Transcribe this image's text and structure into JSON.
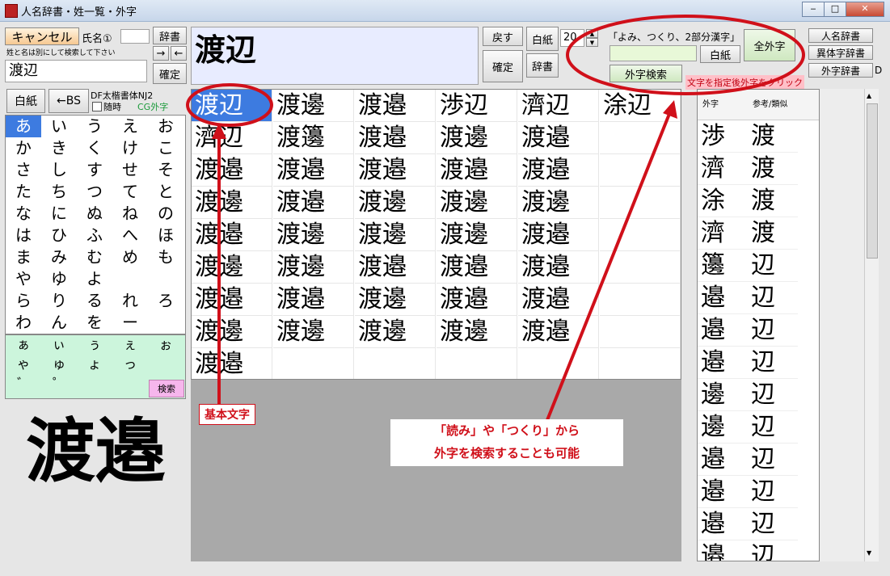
{
  "window": {
    "title": "人名辞書・姓一覧・外字",
    "min": "‒",
    "max": "□",
    "close": "✕"
  },
  "left": {
    "cancel": "キャンセル",
    "name_label": "氏名①",
    "dict_button": "辞書",
    "hint": "姓と名は別にして検索して下さい",
    "arrow_right": "→",
    "arrow_left": "←",
    "input_value": "渡辺",
    "confirm": "確定",
    "blank": "白紙",
    "bs": "←BS",
    "font_name": "DF太楷書体NJ2",
    "checkbox_label": "随時",
    "cg_label": "CG外字",
    "kana_rows": [
      [
        "あ",
        "い",
        "う",
        "え",
        "お"
      ],
      [
        "か",
        "き",
        "く",
        "け",
        "こ"
      ],
      [
        "さ",
        "し",
        "す",
        "せ",
        "そ"
      ],
      [
        "た",
        "ち",
        "つ",
        "て",
        "と"
      ],
      [
        "な",
        "に",
        "ぬ",
        "ね",
        "の"
      ],
      [
        "は",
        "ひ",
        "ふ",
        "へ",
        "ほ"
      ],
      [
        "ま",
        "み",
        "む",
        "め",
        "も"
      ],
      [
        "や",
        "ゆ",
        "よ",
        "",
        ""
      ],
      [
        "ら",
        "り",
        "る",
        "れ",
        "ろ"
      ],
      [
        "わ",
        "ん",
        "を",
        "ー",
        ""
      ]
    ],
    "small_rows": [
      [
        "ぁ",
        "ぃ",
        "ぅ",
        "ぇ",
        "ぉ"
      ],
      [
        "ゃ",
        "ゅ",
        "ょ",
        "っ",
        ""
      ],
      [
        "゛",
        "゜",
        "",
        "",
        ""
      ]
    ],
    "search": "検索",
    "big_preview": "渡邉"
  },
  "center": {
    "display": "渡辺",
    "back": "戻す",
    "confirm": "確定",
    "blank": "白紙",
    "dict": "辞書"
  },
  "right_top": {
    "size": "20",
    "search_caption": "「よみ、つくり、2部分漢字」",
    "blank": "白紙",
    "all_gaiji": "全外字",
    "gaiji_search": "外字検索",
    "gaiji_hint": "文字を指定後外字をクリック",
    "jinmei": "人名辞書",
    "itaiji": "異体字辞書",
    "gaiji_dict": "外字辞書",
    "d": "D"
  },
  "grid": [
    [
      "渡辺",
      "渡邊",
      "渡邉",
      "渉辺",
      "濟辺",
      "涂辺"
    ],
    [
      "濟辺",
      "渡籩",
      "渡邉",
      "渡邊",
      "渡邉",
      ""
    ],
    [
      "渡邉",
      "渡邉",
      "渡邉",
      "渡邉",
      "渡邉",
      ""
    ],
    [
      "渡邊",
      "渡邉",
      "渡邊",
      "渡邊",
      "渡邊",
      ""
    ],
    [
      "渡邉",
      "渡邊",
      "渡邊",
      "渡邊",
      "渡邉",
      ""
    ],
    [
      "渡邊",
      "渡邊",
      "渡邉",
      "渡邉",
      "渡邉",
      ""
    ],
    [
      "渡邉",
      "渡邉",
      "渡邊",
      "渡邉",
      "渡邉",
      ""
    ],
    [
      "渡邊",
      "渡邊",
      "渡邊",
      "渡邊",
      "渡邉",
      ""
    ],
    [
      "渡邉",
      "",
      "",
      "",
      "",
      ""
    ]
  ],
  "right_list": {
    "head1": "外字",
    "head2": "参考/類似",
    "rows": [
      [
        "渉",
        "渡"
      ],
      [
        "濟",
        "渡"
      ],
      [
        "涂",
        "渡"
      ],
      [
        "濟",
        "渡"
      ],
      [
        "籩",
        "辺"
      ],
      [
        "邉",
        "辺"
      ],
      [
        "邉",
        "辺"
      ],
      [
        "邉",
        "辺"
      ],
      [
        "邊",
        "辺"
      ],
      [
        "邊",
        "辺"
      ],
      [
        "邉",
        "辺"
      ],
      [
        "邉",
        "辺"
      ],
      [
        "邉",
        "辺"
      ],
      [
        "邉",
        "辺"
      ]
    ]
  },
  "annotations": {
    "basic": "基本文字",
    "line1": "「読み」や「つくり」から",
    "line2": "外字を検索することも可能"
  },
  "colors": {
    "selection": "#3d7be0",
    "annotation": "#d0101a",
    "small_kana_bg": "#ccf5dc"
  }
}
